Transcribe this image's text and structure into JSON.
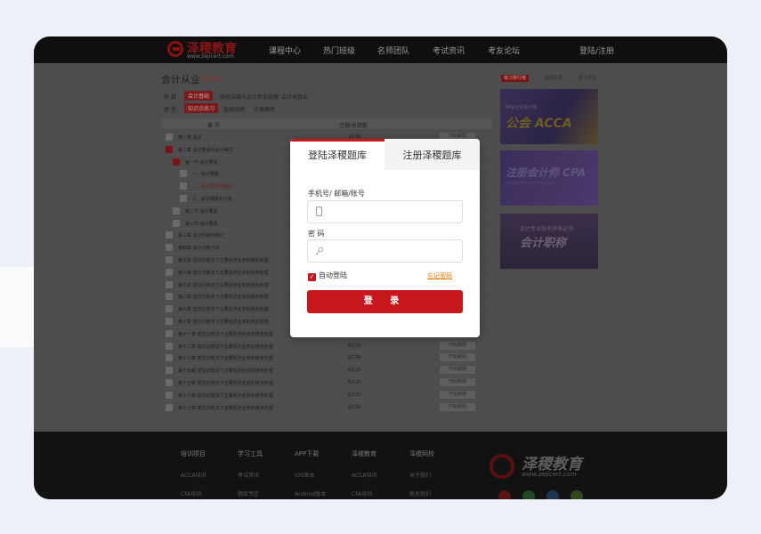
{
  "header": {
    "logo": {
      "name": "泽稷教育",
      "url": "www.zejicert.com"
    },
    "nav": [
      "课程中心",
      "热门班级",
      "名师团队",
      "考试资讯",
      "考友论坛"
    ],
    "auth": "登陆/注册"
  },
  "main": {
    "title": "会计从业",
    "title_link": "切换学科",
    "subject_label": "科  目",
    "subjects": [
      "会计基础",
      "财经法规与会计职业道德",
      "会计电算化"
    ],
    "type_label": "类  型",
    "types": [
      "知识点练习",
      "智能组题",
      "仿真模考"
    ],
    "table_headers": [
      "章  节",
      "已做/总题数"
    ],
    "rows": [
      {
        "text": "第一章  总论",
        "progress": "10/36",
        "action": "开始做题"
      },
      {
        "text": "第二章  会计要素与会计等式",
        "progress": "",
        "action": ""
      },
      {
        "text": "第一节  会计要素",
        "progress": "",
        "action": ""
      },
      {
        "text": "一、会计要素",
        "progress": "",
        "action": ""
      },
      {
        "text": "二、会计要素的确认",
        "progress": "",
        "action": ""
      },
      {
        "text": "三、会计要素的计量",
        "progress": "",
        "action": ""
      },
      {
        "text": "第二节  会计要素",
        "progress": "",
        "action": ""
      },
      {
        "text": "第三节  会计要素",
        "progress": "",
        "action": ""
      },
      {
        "text": "第三章  会计科目与账户",
        "progress": "",
        "action": ""
      },
      {
        "text": "第四章  会计记账方法",
        "progress": "",
        "action": ""
      },
      {
        "text": "第五章  借贷记账法下主要经济业务的账务处理",
        "progress": "",
        "action": ""
      },
      {
        "text": "第六章  借贷记账法下主要经济业务的账务处理",
        "progress": "",
        "action": ""
      },
      {
        "text": "第七章  借贷记账法下主要经济业务的账务处理",
        "progress": "",
        "action": ""
      },
      {
        "text": "第八章  借贷记账法下主要经济业务的账务处理",
        "progress": "",
        "action": ""
      },
      {
        "text": "第九章  借贷记账法下主要经济业务的账务处理",
        "progress": "",
        "action": ""
      },
      {
        "text": "第十章  借贷记账法下主要经济业务的账务处理",
        "progress": "",
        "action": ""
      },
      {
        "text": "第十一章  借贷记账法下主要经济业务的账务处理",
        "progress": "6/120",
        "action": "开始做题"
      },
      {
        "text": "第十二章  借贷记账法下主要经济业务的账务处理",
        "progress": "6/120",
        "action": "开始做题"
      },
      {
        "text": "第十三章  借贷记账法下主要经济业务的账务处理",
        "progress": "6/120",
        "action": "开始做题"
      },
      {
        "text": "第十四章  借贷记账法下主要经济业务的账务处理",
        "progress": "6/120",
        "action": "开始做题"
      },
      {
        "text": "第十五章  借贷记账法下主要经济业务的账务处理",
        "progress": "6/120",
        "action": "开始做题"
      },
      {
        "text": "第十六章  借贷记账法下主要经济业务的账务处理",
        "progress": "6/120",
        "action": "开始做题"
      },
      {
        "text": "第十七章  借贷记账法下主要经济业务的账务处理",
        "progress": "6/120",
        "action": "开始做题"
      }
    ]
  },
  "sidebar": {
    "tabs": [
      "练习排行榜",
      "错题记录",
      "能力评估"
    ],
    "banners": [
      {
        "caption": "公会 ACCA",
        "small": "特许公认会计师"
      },
      {
        "caption": "注册会计师 CPA",
        "small": "Certified Public Accountant"
      },
      {
        "caption": "会计职称",
        "small": "会计专业技术资格证书"
      }
    ]
  },
  "footer": {
    "columns": [
      {
        "title": "培训项目",
        "links": [
          "ACCA培训",
          "CFA培训"
        ]
      },
      {
        "title": "学习工具",
        "links": [
          "考试资讯",
          "题库专区"
        ]
      },
      {
        "title": "APP下载",
        "links": [
          "iOS版本",
          "Android版本"
        ]
      },
      {
        "title": "泽稷教育",
        "links": [
          "ACCA培训",
          "CFA培训"
        ]
      },
      {
        "title": "泽稷网校",
        "links": [
          "关于我们",
          "联系我们"
        ]
      }
    ],
    "logo": {
      "name": "泽稷教育",
      "url": "www.zejicert.com"
    }
  },
  "modal": {
    "tab_login": "登陆泽稷题库",
    "tab_register": "注册泽稷题库",
    "account_label": "手机号/ 邮箱/账号",
    "account_value": "",
    "password_label": "密  码",
    "password_value": "",
    "remember_label": "自动登陆",
    "remember_checked": true,
    "forgot_label": "忘记密码",
    "submit_label": "登 录"
  },
  "colors": {
    "accent": "#c8161d",
    "link_orange": "#e57b00",
    "overlay": "#4d4d4d"
  }
}
